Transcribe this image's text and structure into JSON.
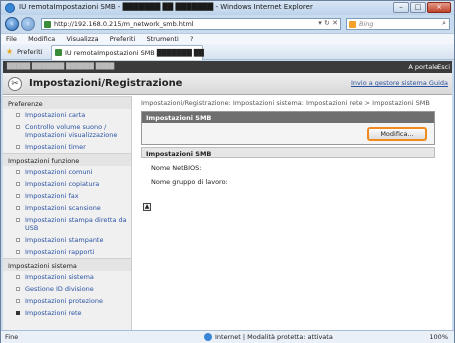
{
  "window": {
    "title": "IU remotaImpostazioni SMB - ███████ ██ ███████ - Windows Internet Explorer",
    "buttons": [
      "–",
      "□",
      "×"
    ]
  },
  "browser": {
    "url": "http://192.168.0.215/m_network_smb.html",
    "search_placeholder": "Bing",
    "menu": [
      "File",
      "Modifica",
      "Visualizza",
      "Preferiti",
      "Strumenti",
      "?"
    ],
    "favorites_label": "Preferiti",
    "tab_label": "IU remotaImpostazioni SMB ███████ ██",
    "status_left": "Fine",
    "status_zone": "Internet | Modalità protetta: attivata",
    "zoom": "100%"
  },
  "page": {
    "device_bar": "█████ ███████ ██████ ████",
    "portal_link": "A portale",
    "exit_link": "Esci",
    "title": "Impostazioni/Registrazione",
    "header_links": "Invio a gestore sistema  Guida",
    "breadcrumb": "Impostazioni/Registrazione: Impostazioni sistema: Impostazioni rete > Impostazioni SMB",
    "panel1_title": "Impostazioni SMB",
    "edit_button": "Modifica...",
    "panel2_title": "Impostazioni SMB",
    "netbios_label": "Nome NetBIOS:",
    "workgroup_label": "Nome gruppo di lavoro:"
  },
  "sidebar": {
    "sections": [
      {
        "title": "Preferenze",
        "items": [
          "Impostazioni carta",
          "Controllo volume suono / Impostazioni visualizzazione",
          "Impostazioni timer"
        ]
      },
      {
        "title": "Impostazioni funzione",
        "items": [
          "Impostazioni comuni",
          "Impostazioni copiatura",
          "Impostazioni fax",
          "Impostazioni scansione",
          "Impostazioni stampa diretta da USB",
          "Impostazioni stampante",
          "Impostazioni rapporti"
        ]
      },
      {
        "title": "Impostazioni sistema",
        "items": [
          "Impostazioni sistema",
          "Gestione ID divisione",
          "Impostazioni protezione",
          "Impostazioni rete"
        ]
      }
    ]
  }
}
